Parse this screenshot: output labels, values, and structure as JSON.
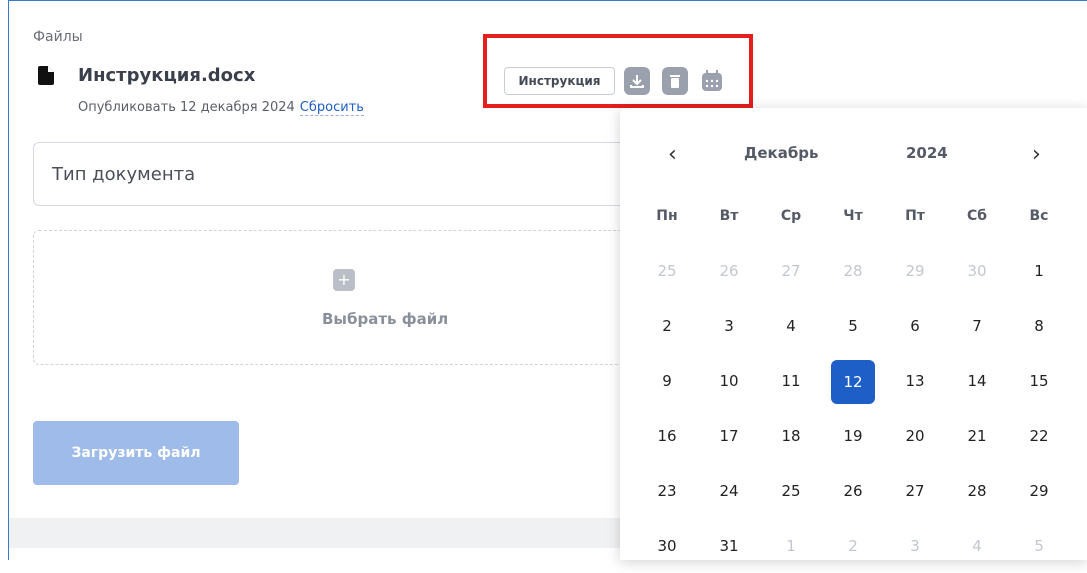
{
  "files": {
    "section_label": "Файлы",
    "file_name": "Инструкция.docx",
    "publish_label": "Опубликовать 12 декабря 2024",
    "reset_link": "Сбросить",
    "tag_button": "Инструкция",
    "icons": [
      "download-icon",
      "trash-icon",
      "calendar-icon"
    ],
    "doc_type_placeholder": "Тип документа",
    "choose_file": "Выбрать файл",
    "upload_button": "Загрузить файл"
  },
  "calendar": {
    "prev": "‹",
    "next": "›",
    "month": "Декабрь",
    "year": "2024",
    "weekdays": [
      "Пн",
      "Вт",
      "Ср",
      "Чт",
      "Пт",
      "Сб",
      "Вс"
    ],
    "weeks": [
      [
        {
          "d": "25",
          "m": true
        },
        {
          "d": "26",
          "m": true
        },
        {
          "d": "27",
          "m": true
        },
        {
          "d": "28",
          "m": true
        },
        {
          "d": "29",
          "m": true
        },
        {
          "d": "30",
          "m": true
        },
        {
          "d": "1"
        }
      ],
      [
        {
          "d": "2"
        },
        {
          "d": "3"
        },
        {
          "d": "4"
        },
        {
          "d": "5"
        },
        {
          "d": "6"
        },
        {
          "d": "7"
        },
        {
          "d": "8"
        }
      ],
      [
        {
          "d": "9"
        },
        {
          "d": "10"
        },
        {
          "d": "11"
        },
        {
          "d": "12",
          "s": true
        },
        {
          "d": "13"
        },
        {
          "d": "14"
        },
        {
          "d": "15"
        }
      ],
      [
        {
          "d": "16"
        },
        {
          "d": "17"
        },
        {
          "d": "18"
        },
        {
          "d": "19"
        },
        {
          "d": "20"
        },
        {
          "d": "21"
        },
        {
          "d": "22"
        }
      ],
      [
        {
          "d": "23"
        },
        {
          "d": "24"
        },
        {
          "d": "25"
        },
        {
          "d": "26"
        },
        {
          "d": "27"
        },
        {
          "d": "28"
        },
        {
          "d": "29"
        }
      ],
      [
        {
          "d": "30"
        },
        {
          "d": "31"
        },
        {
          "d": "1",
          "m": true
        },
        {
          "d": "2",
          "m": true
        },
        {
          "d": "3",
          "m": true
        },
        {
          "d": "4",
          "m": true
        },
        {
          "d": "5",
          "m": true
        }
      ]
    ],
    "selected_color": "#1e5fc7"
  },
  "highlight_color": "#e51e1e"
}
